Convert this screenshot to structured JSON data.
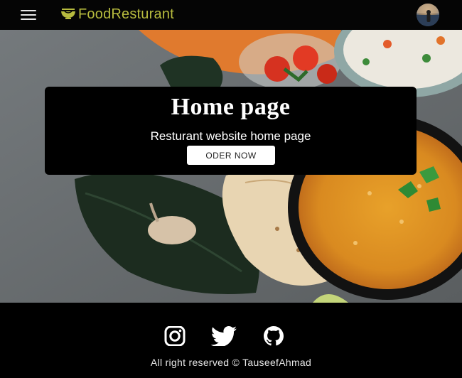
{
  "navbar": {
    "menu_icon": "hamburger-menu-icon",
    "brand_icon": "bowl-icon",
    "brand_text": "FoodResturant",
    "avatar": "user-avatar"
  },
  "hero": {
    "title": "Home page",
    "subtitle": "Resturant website home page",
    "order_button": "ODER NOW"
  },
  "footer": {
    "social": [
      {
        "icon": "instagram-icon"
      },
      {
        "icon": "twitter-icon"
      },
      {
        "icon": "github-icon"
      }
    ],
    "copyright": "All right reserved © TauseefAhmad"
  },
  "colors": {
    "brand": "#b7bb3e",
    "navbar_bg": "#050505",
    "footer_bg": "#000000",
    "card_bg": "#000000",
    "button_bg": "#ffffff"
  }
}
